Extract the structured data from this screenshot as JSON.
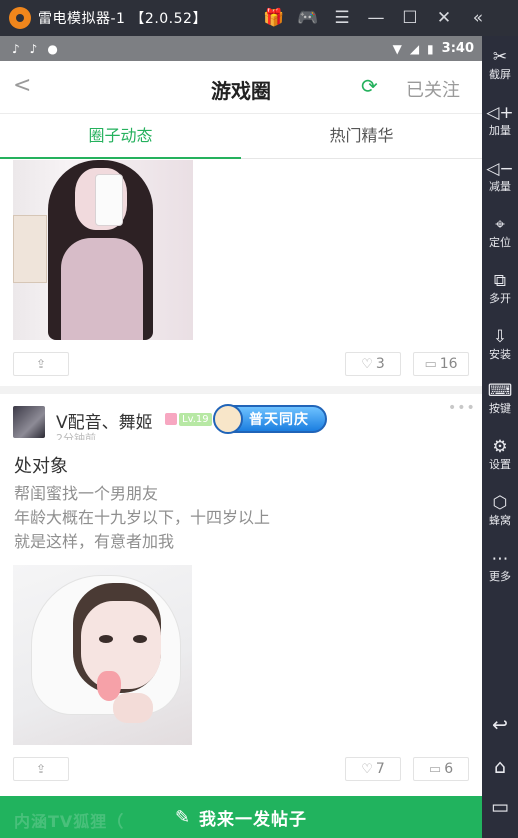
{
  "emulator": {
    "title": "雷电模拟器-1 【2.0.52】",
    "icons": [
      "gift-icon",
      "gamepad-icon",
      "menu-icon",
      "minimize-icon",
      "maximize-icon",
      "close-icon",
      "collapse-icon"
    ]
  },
  "sidebar": {
    "items": [
      {
        "icon": "screenshot-icon",
        "label": "截屏"
      },
      {
        "icon": "volume-up-icon",
        "label": "加量"
      },
      {
        "icon": "volume-down-icon",
        "label": "减量"
      },
      {
        "icon": "location-icon",
        "label": "定位"
      },
      {
        "icon": "multi-open-icon",
        "label": "多开"
      },
      {
        "icon": "apk-install-icon",
        "label": "安装"
      },
      {
        "icon": "keyboard-icon",
        "label": "按键"
      },
      {
        "icon": "settings-icon",
        "label": "设置"
      },
      {
        "icon": "hive-icon",
        "label": "蜂窝"
      },
      {
        "icon": "more-icon",
        "label": "更多"
      }
    ],
    "nav": [
      "back-icon",
      "home-icon",
      "recents-icon"
    ]
  },
  "status_bar": {
    "time": "3:40"
  },
  "header": {
    "title": "游戏圈",
    "follow_label": "已关注"
  },
  "tabs": [
    {
      "label": "圈子动态",
      "active": true
    },
    {
      "label": "热门精华",
      "active": false
    }
  ],
  "posts": [
    {
      "likes": "3",
      "comments": "16"
    },
    {
      "username": "V配音、舞姬",
      "level": "Lv.19",
      "badge": "普天同庆",
      "time": "2分钟前",
      "title": "处对象",
      "body": [
        "帮闺蜜找一个男朋友",
        "年龄大概在十九岁以下，十四岁以上",
        "就是这样，有意者加我"
      ],
      "likes": "7",
      "comments": "6"
    }
  ],
  "post_button": {
    "label": "我来一发帖子",
    "watermark": "内涵TV狐狸（"
  },
  "colors": {
    "accent": "#21b35e",
    "emulator_bg": "#2d3039"
  }
}
